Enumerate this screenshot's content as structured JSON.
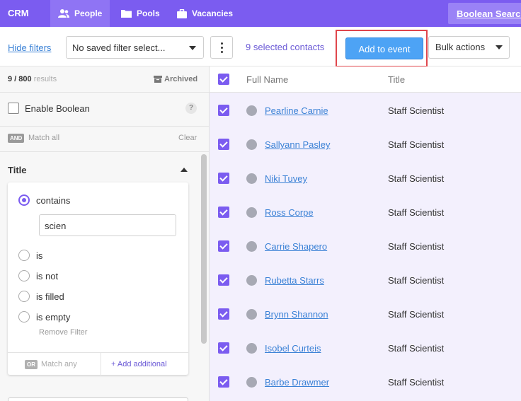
{
  "nav": {
    "app": "CRM",
    "tabs": [
      {
        "label": "People",
        "icon": "people-icon",
        "active": true
      },
      {
        "label": "Pools",
        "icon": "folder-icon",
        "active": false
      },
      {
        "label": "Vacancies",
        "icon": "briefcase-icon",
        "active": false
      }
    ],
    "boolean_search": "Boolean Search"
  },
  "toolbar": {
    "hide_filters": "Hide filters",
    "saved_filter": "No saved filter select...",
    "selected_count": "9 selected contacts",
    "add_to_event": "Add to event",
    "bulk_actions": "Bulk actions"
  },
  "filters": {
    "results_count": "9 / 800",
    "results_label": "results",
    "archived": "Archived",
    "enable_boolean": "Enable Boolean",
    "help": "?",
    "and_badge": "AND",
    "match_all": "Match all",
    "clear": "Clear",
    "section_title": "Title",
    "options": [
      {
        "label": "contains",
        "checked": true
      },
      {
        "label": "is",
        "checked": false
      },
      {
        "label": "is not",
        "checked": false
      },
      {
        "label": "is filled",
        "checked": false
      },
      {
        "label": "is empty",
        "checked": false
      }
    ],
    "value": "scien",
    "remove_filter": "Remove Filter",
    "or_badge": "OR",
    "match_any": "Match any",
    "add_additional": "+ Add additional"
  },
  "table": {
    "columns": [
      "Full Name",
      "Title"
    ],
    "rows": [
      {
        "name": "Pearline Carnie",
        "title": "Staff Scientist",
        "selected": true
      },
      {
        "name": "Sallyann Pasley",
        "title": "Staff Scientist",
        "selected": true
      },
      {
        "name": "Niki Tuvey",
        "title": "Staff Scientist",
        "selected": true
      },
      {
        "name": "Ross Corpe",
        "title": "Staff Scientist",
        "selected": true
      },
      {
        "name": "Carrie Shapero",
        "title": "Staff Scientist",
        "selected": true
      },
      {
        "name": "Rubetta Starrs",
        "title": "Staff Scientist",
        "selected": true
      },
      {
        "name": "Brynn Shannon",
        "title": "Staff Scientist",
        "selected": true
      },
      {
        "name": "Isobel Curteis",
        "title": "Staff Scientist",
        "selected": true
      },
      {
        "name": "Barbe Drawmer",
        "title": "Staff Scientist",
        "selected": true
      }
    ]
  },
  "colors": {
    "brand": "#7b5cf0",
    "primary_button": "#4da3f5",
    "highlight": "#e0464c",
    "link": "#3b82d6"
  }
}
